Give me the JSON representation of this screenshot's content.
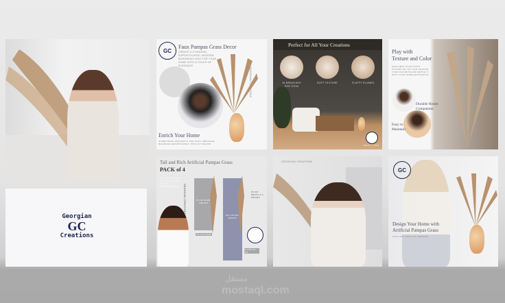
{
  "brand": {
    "name": "Georgian Creations",
    "logo_top": "Georgian",
    "logo_bottom": "Creations",
    "monogram": "GC",
    "color": "#1d2350"
  },
  "tiles": {
    "faux": {
      "title": "Faux Pampas Grass Decor",
      "subtitle": "Create a stunning, sophisticated, modern bohemian look for your home with a touch of elegance",
      "side_label": "GEORGIAN CREATIONS",
      "heading2": "Enrich Your Home",
      "body2": "Super boho aesthetic and cozy ambiance, blending effortlessly into any decor"
    },
    "perfect": {
      "title": "Perfect for All Your Creations",
      "features": [
        "18 branches per stem",
        "Soft texture",
        "Fluffy plumes"
      ],
      "badge": "Bendy stem"
    },
    "texture": {
      "title_line1": "Play with",
      "title_line2": "Texture and Color",
      "body": "Available in multiple colors so you can choose your favorite and match it with your home aesthetics",
      "feature1_line1": "Durable Room",
      "feature1_line2": "Companion",
      "feature2_line1": "Easy to",
      "feature2_line2": "Maintain"
    },
    "pack": {
      "title": "Tall and Rich Artificial Pampas Grass",
      "subtitle": "PACK of 4",
      "side_label": "GEORGIAN CREATIONS",
      "note": "Cut to fit into any vase, even plant arrangements",
      "plume": "75 cm plume height",
      "stem": "15 cm stem",
      "max": "110 cm max height",
      "width": "25 cm width & 4 pieces",
      "extra": "Extra 20 cm"
    },
    "girl": {
      "label": "GEORGIAN CREATIONS"
    },
    "design": {
      "title_line1": "Design Your Home with",
      "title_line2": "Artificial Pampas Grass",
      "subtitle": "For cozy and chic designs"
    }
  },
  "watermark": {
    "text": "mostaql.com",
    "arabic": "مستقل"
  }
}
